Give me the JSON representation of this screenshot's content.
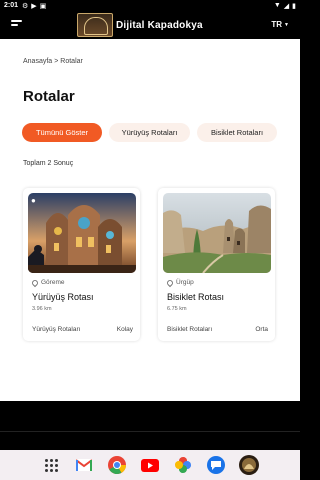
{
  "status_bar": {
    "time": "2:01"
  },
  "header": {
    "logo_text": "Dijital Kapadokya",
    "language": "TR"
  },
  "breadcrumb": {
    "home": "Anasayfa",
    "separator": ">",
    "current": "Rotalar"
  },
  "page": {
    "title": "Rotalar"
  },
  "filters": {
    "all": "Tümünü Göster",
    "walking": "Yürüyüş Rotaları",
    "bicycle": "Bisiklet Rotaları"
  },
  "results": {
    "count_text": "Toplam 2 Sonuç"
  },
  "cards": [
    {
      "location": "Göreme",
      "title": "Yürüyüş Rotası",
      "distance": "3.96 km",
      "category": "Yürüyüş Rotaları",
      "difficulty": "Kolay"
    },
    {
      "location": "Ürgüp",
      "title": "Bisiklet Rotası",
      "distance": "6.75 km",
      "category": "Bisiklet Rotaları",
      "difficulty": "Orta"
    }
  ],
  "colors": {
    "accent": "#f15a24",
    "chip_bg": "#fbf0ea",
    "header_bg": "#000000"
  },
  "dock": {
    "apps": [
      "app-drawer-icon",
      "gmail-icon",
      "chrome-icon",
      "youtube-icon",
      "photos-icon",
      "messages-icon",
      "kapadokya-app-icon"
    ]
  }
}
